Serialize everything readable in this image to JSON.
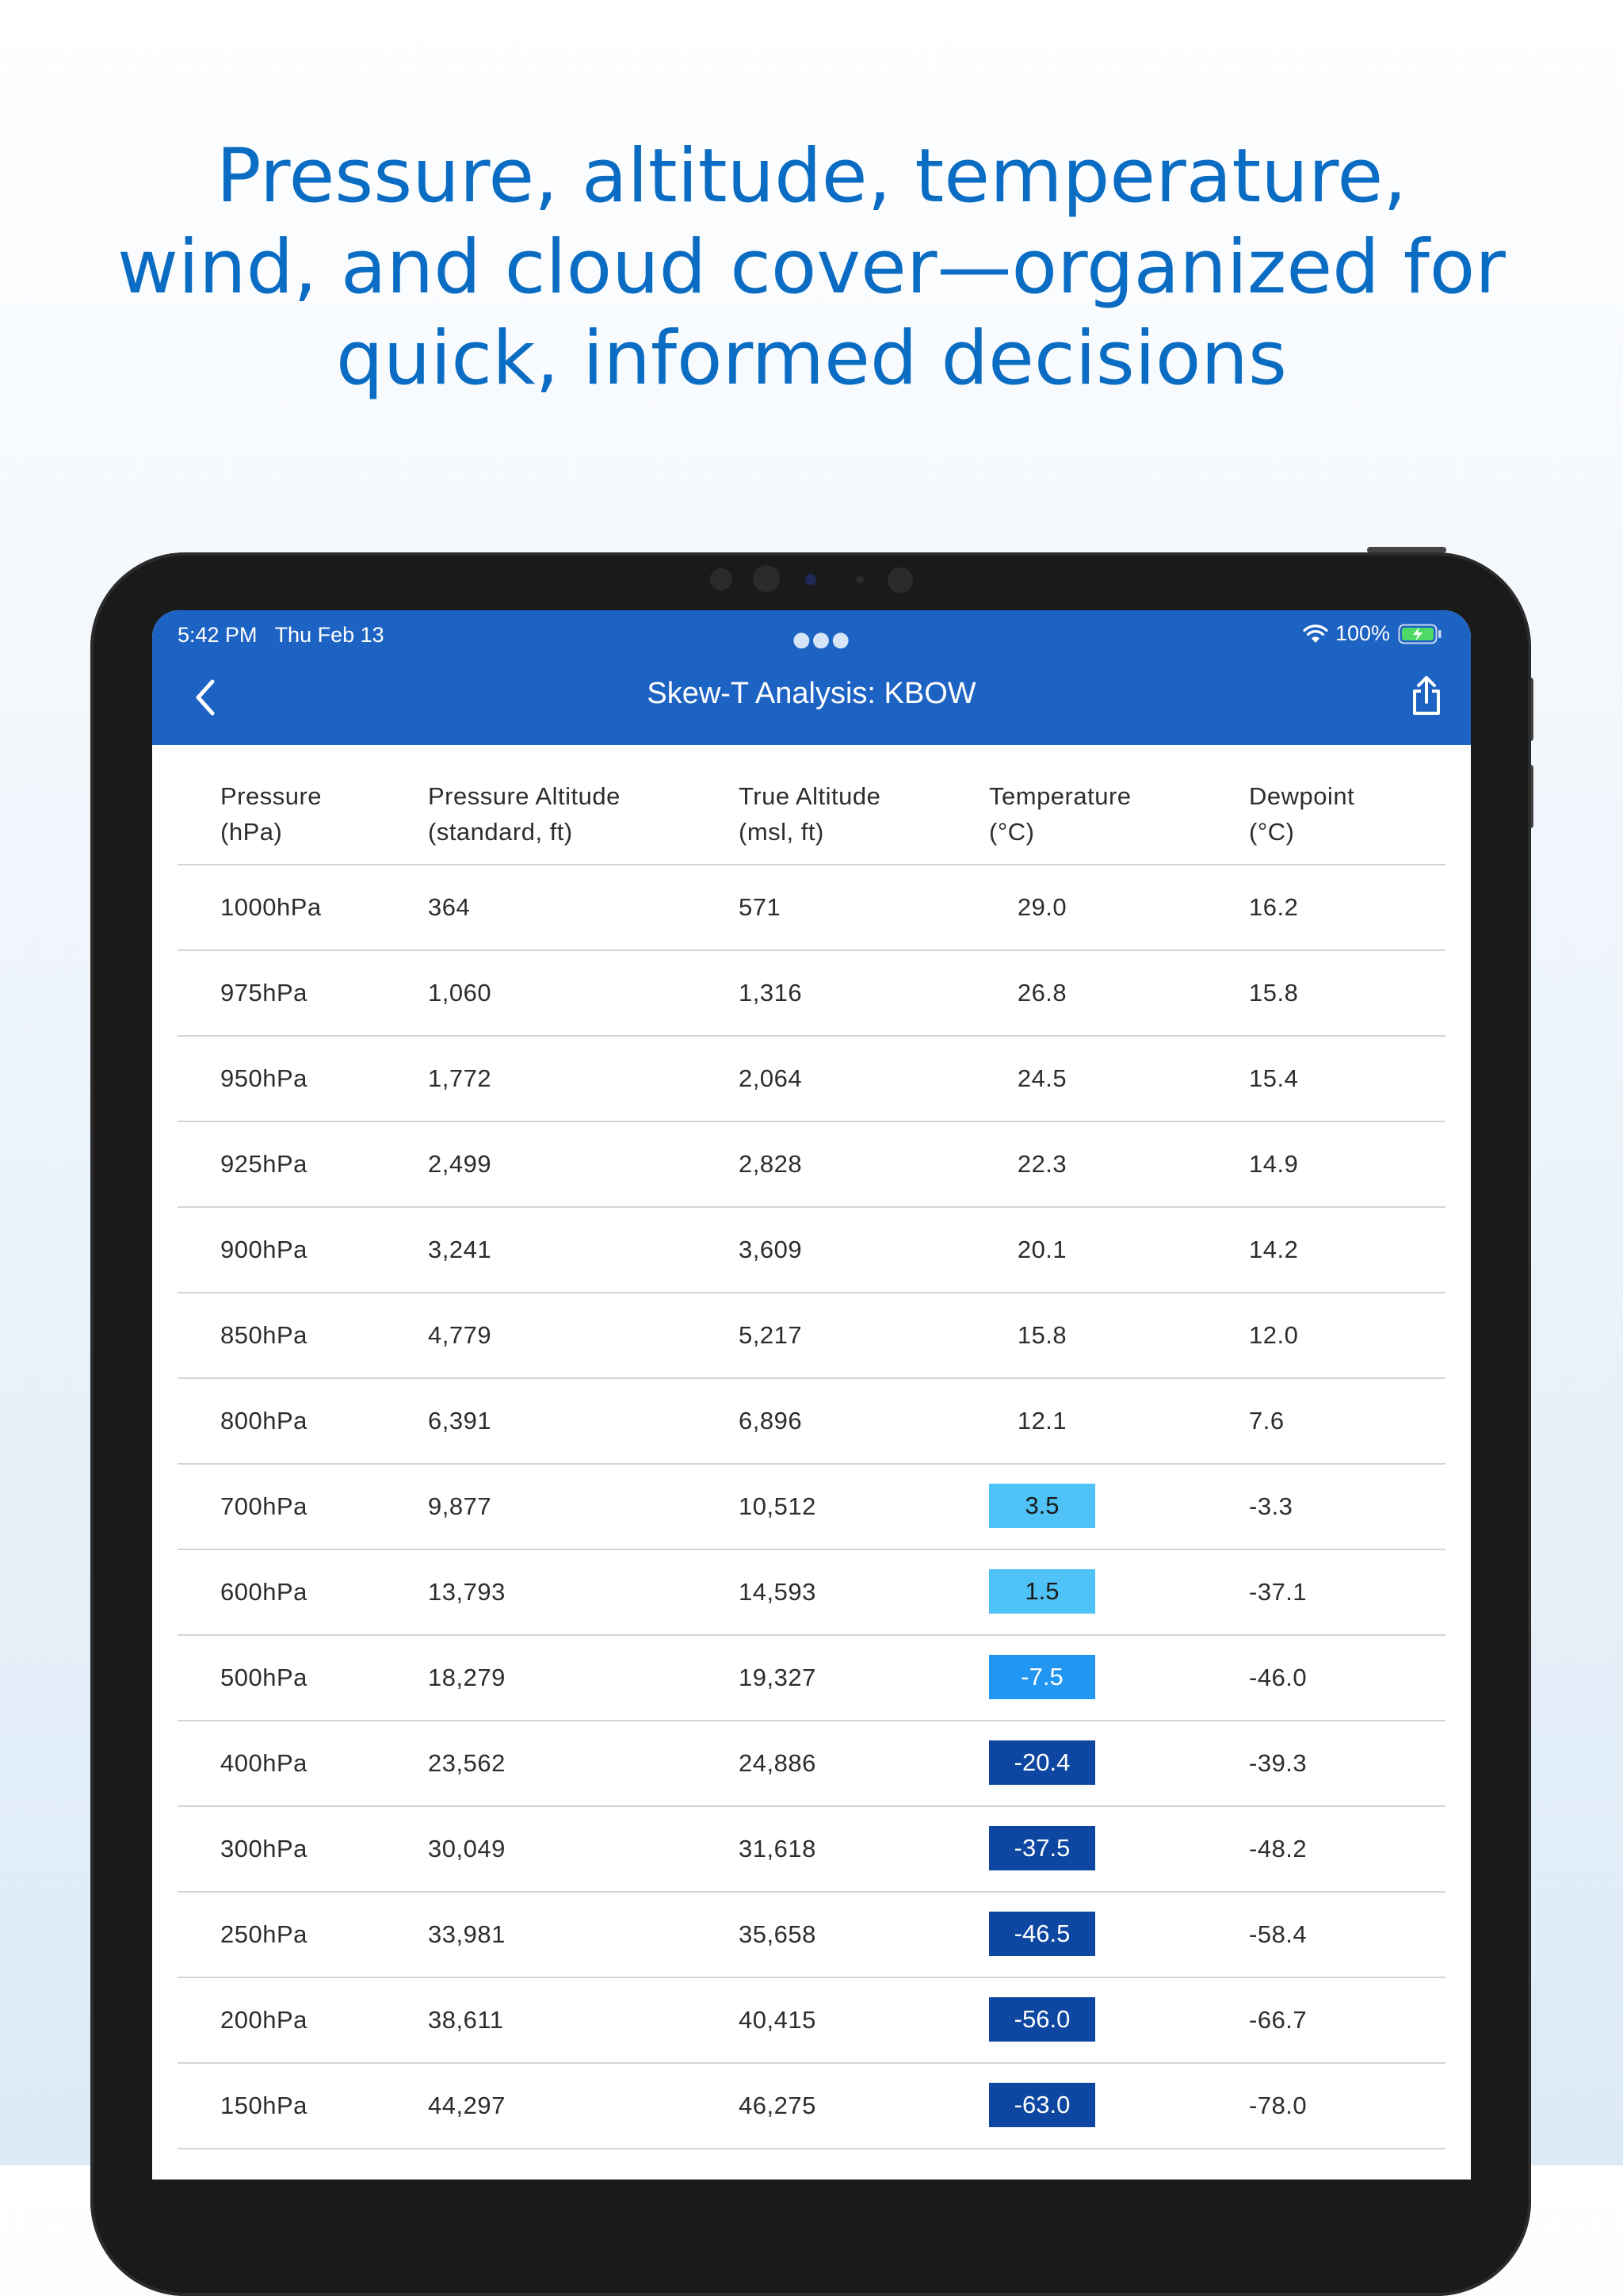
{
  "headline": {
    "line1": "Pressure, altitude, temperature,",
    "line2": "wind, and cloud cover—organized for",
    "line3": "quick, informed decisions"
  },
  "status_bar": {
    "time": "5:42 PM",
    "date": "Thu Feb 13",
    "battery": "100%"
  },
  "nav": {
    "title": "Skew-T Analysis: KBOW",
    "back_icon": "chevron-left-icon",
    "share_icon": "share-icon"
  },
  "table": {
    "headers": [
      {
        "line1": "Pressure",
        "line2": "(hPa)"
      },
      {
        "line1": "Pressure Altitude",
        "line2": "(standard, ft)"
      },
      {
        "line1": "True Altitude",
        "line2": "(msl, ft)"
      },
      {
        "line1": "Temperature",
        "line2": "(°C)"
      },
      {
        "line1": "Dewpoint",
        "line2": "(°C)"
      }
    ],
    "rows": [
      {
        "pressure": "1000hPa",
        "pressure_alt": "364",
        "true_alt": "571",
        "temp": "29.0",
        "dewpoint": "16.2"
      },
      {
        "pressure": "975hPa",
        "pressure_alt": "1,060",
        "true_alt": "1,316",
        "temp": "26.8",
        "dewpoint": "15.8"
      },
      {
        "pressure": "950hPa",
        "pressure_alt": "1,772",
        "true_alt": "2,064",
        "temp": "24.5",
        "dewpoint": "15.4"
      },
      {
        "pressure": "925hPa",
        "pressure_alt": "2,499",
        "true_alt": "2,828",
        "temp": "22.3",
        "dewpoint": "14.9"
      },
      {
        "pressure": "900hPa",
        "pressure_alt": "3,241",
        "true_alt": "3,609",
        "temp": "20.1",
        "dewpoint": "14.2"
      },
      {
        "pressure": "850hPa",
        "pressure_alt": "4,779",
        "true_alt": "5,217",
        "temp": "15.8",
        "dewpoint": "12.0"
      },
      {
        "pressure": "800hPa",
        "pressure_alt": "6,391",
        "true_alt": "6,896",
        "temp": "12.1",
        "dewpoint": "7.6"
      },
      {
        "pressure": "700hPa",
        "pressure_alt": "9,877",
        "true_alt": "10,512",
        "temp": "3.5",
        "dewpoint": "-3.3",
        "temp_bg": "#4fc3f7",
        "temp_fg": "#1a1a1a"
      },
      {
        "pressure": "600hPa",
        "pressure_alt": "13,793",
        "true_alt": "14,593",
        "temp": "1.5",
        "dewpoint": "-37.1",
        "temp_bg": "#4fc3f7",
        "temp_fg": "#1a1a1a"
      },
      {
        "pressure": "500hPa",
        "pressure_alt": "18,279",
        "true_alt": "19,327",
        "temp": "-7.5",
        "dewpoint": "-46.0",
        "temp_bg": "#2196f3",
        "temp_fg": "#ffffff"
      },
      {
        "pressure": "400hPa",
        "pressure_alt": "23,562",
        "true_alt": "24,886",
        "temp": "-20.4",
        "dewpoint": "-39.3",
        "temp_bg": "#0d47a1",
        "temp_fg": "#ffffff"
      },
      {
        "pressure": "300hPa",
        "pressure_alt": "30,049",
        "true_alt": "31,618",
        "temp": "-37.5",
        "dewpoint": "-48.2",
        "temp_bg": "#0d47a1",
        "temp_fg": "#ffffff"
      },
      {
        "pressure": "250hPa",
        "pressure_alt": "33,981",
        "true_alt": "35,658",
        "temp": "-46.5",
        "dewpoint": "-58.4",
        "temp_bg": "#0d47a1",
        "temp_fg": "#ffffff"
      },
      {
        "pressure": "200hPa",
        "pressure_alt": "38,611",
        "true_alt": "40,415",
        "temp": "-56.0",
        "dewpoint": "-66.7",
        "temp_bg": "#0d47a1",
        "temp_fg": "#ffffff"
      },
      {
        "pressure": "150hPa",
        "pressure_alt": "44,297",
        "true_alt": "46,275",
        "temp": "-63.0",
        "dewpoint": "-78.0",
        "temp_bg": "#0d47a1",
        "temp_fg": "#ffffff"
      }
    ]
  },
  "colors": {
    "headline": "#0a6cc2",
    "app_bar": "#1d63c4",
    "row_divider": "#d4d4d4"
  }
}
